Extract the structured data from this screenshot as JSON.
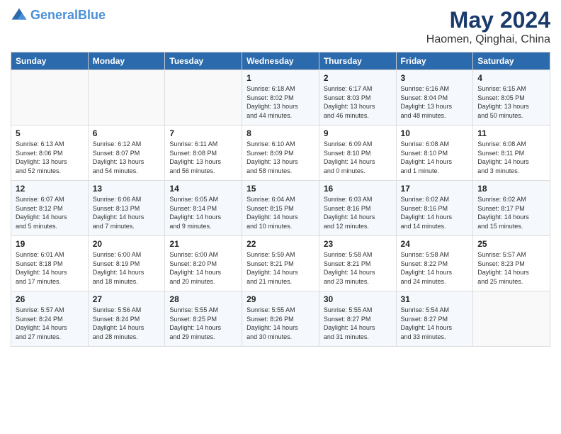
{
  "header": {
    "logo_line1": "General",
    "logo_line2": "Blue",
    "title": "May 2024",
    "subtitle": "Haomen, Qinghai, China"
  },
  "weekdays": [
    "Sunday",
    "Monday",
    "Tuesday",
    "Wednesday",
    "Thursday",
    "Friday",
    "Saturday"
  ],
  "weeks": [
    [
      {
        "day": "",
        "info": ""
      },
      {
        "day": "",
        "info": ""
      },
      {
        "day": "",
        "info": ""
      },
      {
        "day": "1",
        "info": "Sunrise: 6:18 AM\nSunset: 8:02 PM\nDaylight: 13 hours\nand 44 minutes."
      },
      {
        "day": "2",
        "info": "Sunrise: 6:17 AM\nSunset: 8:03 PM\nDaylight: 13 hours\nand 46 minutes."
      },
      {
        "day": "3",
        "info": "Sunrise: 6:16 AM\nSunset: 8:04 PM\nDaylight: 13 hours\nand 48 minutes."
      },
      {
        "day": "4",
        "info": "Sunrise: 6:15 AM\nSunset: 8:05 PM\nDaylight: 13 hours\nand 50 minutes."
      }
    ],
    [
      {
        "day": "5",
        "info": "Sunrise: 6:13 AM\nSunset: 8:06 PM\nDaylight: 13 hours\nand 52 minutes."
      },
      {
        "day": "6",
        "info": "Sunrise: 6:12 AM\nSunset: 8:07 PM\nDaylight: 13 hours\nand 54 minutes."
      },
      {
        "day": "7",
        "info": "Sunrise: 6:11 AM\nSunset: 8:08 PM\nDaylight: 13 hours\nand 56 minutes."
      },
      {
        "day": "8",
        "info": "Sunrise: 6:10 AM\nSunset: 8:09 PM\nDaylight: 13 hours\nand 58 minutes."
      },
      {
        "day": "9",
        "info": "Sunrise: 6:09 AM\nSunset: 8:10 PM\nDaylight: 14 hours\nand 0 minutes."
      },
      {
        "day": "10",
        "info": "Sunrise: 6:08 AM\nSunset: 8:10 PM\nDaylight: 14 hours\nand 1 minute."
      },
      {
        "day": "11",
        "info": "Sunrise: 6:08 AM\nSunset: 8:11 PM\nDaylight: 14 hours\nand 3 minutes."
      }
    ],
    [
      {
        "day": "12",
        "info": "Sunrise: 6:07 AM\nSunset: 8:12 PM\nDaylight: 14 hours\nand 5 minutes."
      },
      {
        "day": "13",
        "info": "Sunrise: 6:06 AM\nSunset: 8:13 PM\nDaylight: 14 hours\nand 7 minutes."
      },
      {
        "day": "14",
        "info": "Sunrise: 6:05 AM\nSunset: 8:14 PM\nDaylight: 14 hours\nand 9 minutes."
      },
      {
        "day": "15",
        "info": "Sunrise: 6:04 AM\nSunset: 8:15 PM\nDaylight: 14 hours\nand 10 minutes."
      },
      {
        "day": "16",
        "info": "Sunrise: 6:03 AM\nSunset: 8:16 PM\nDaylight: 14 hours\nand 12 minutes."
      },
      {
        "day": "17",
        "info": "Sunrise: 6:02 AM\nSunset: 8:16 PM\nDaylight: 14 hours\nand 14 minutes."
      },
      {
        "day": "18",
        "info": "Sunrise: 6:02 AM\nSunset: 8:17 PM\nDaylight: 14 hours\nand 15 minutes."
      }
    ],
    [
      {
        "day": "19",
        "info": "Sunrise: 6:01 AM\nSunset: 8:18 PM\nDaylight: 14 hours\nand 17 minutes."
      },
      {
        "day": "20",
        "info": "Sunrise: 6:00 AM\nSunset: 8:19 PM\nDaylight: 14 hours\nand 18 minutes."
      },
      {
        "day": "21",
        "info": "Sunrise: 6:00 AM\nSunset: 8:20 PM\nDaylight: 14 hours\nand 20 minutes."
      },
      {
        "day": "22",
        "info": "Sunrise: 5:59 AM\nSunset: 8:21 PM\nDaylight: 14 hours\nand 21 minutes."
      },
      {
        "day": "23",
        "info": "Sunrise: 5:58 AM\nSunset: 8:21 PM\nDaylight: 14 hours\nand 23 minutes."
      },
      {
        "day": "24",
        "info": "Sunrise: 5:58 AM\nSunset: 8:22 PM\nDaylight: 14 hours\nand 24 minutes."
      },
      {
        "day": "25",
        "info": "Sunrise: 5:57 AM\nSunset: 8:23 PM\nDaylight: 14 hours\nand 25 minutes."
      }
    ],
    [
      {
        "day": "26",
        "info": "Sunrise: 5:57 AM\nSunset: 8:24 PM\nDaylight: 14 hours\nand 27 minutes."
      },
      {
        "day": "27",
        "info": "Sunrise: 5:56 AM\nSunset: 8:24 PM\nDaylight: 14 hours\nand 28 minutes."
      },
      {
        "day": "28",
        "info": "Sunrise: 5:55 AM\nSunset: 8:25 PM\nDaylight: 14 hours\nand 29 minutes."
      },
      {
        "day": "29",
        "info": "Sunrise: 5:55 AM\nSunset: 8:26 PM\nDaylight: 14 hours\nand 30 minutes."
      },
      {
        "day": "30",
        "info": "Sunrise: 5:55 AM\nSunset: 8:27 PM\nDaylight: 14 hours\nand 31 minutes."
      },
      {
        "day": "31",
        "info": "Sunrise: 5:54 AM\nSunset: 8:27 PM\nDaylight: 14 hours\nand 33 minutes."
      },
      {
        "day": "",
        "info": ""
      }
    ]
  ]
}
